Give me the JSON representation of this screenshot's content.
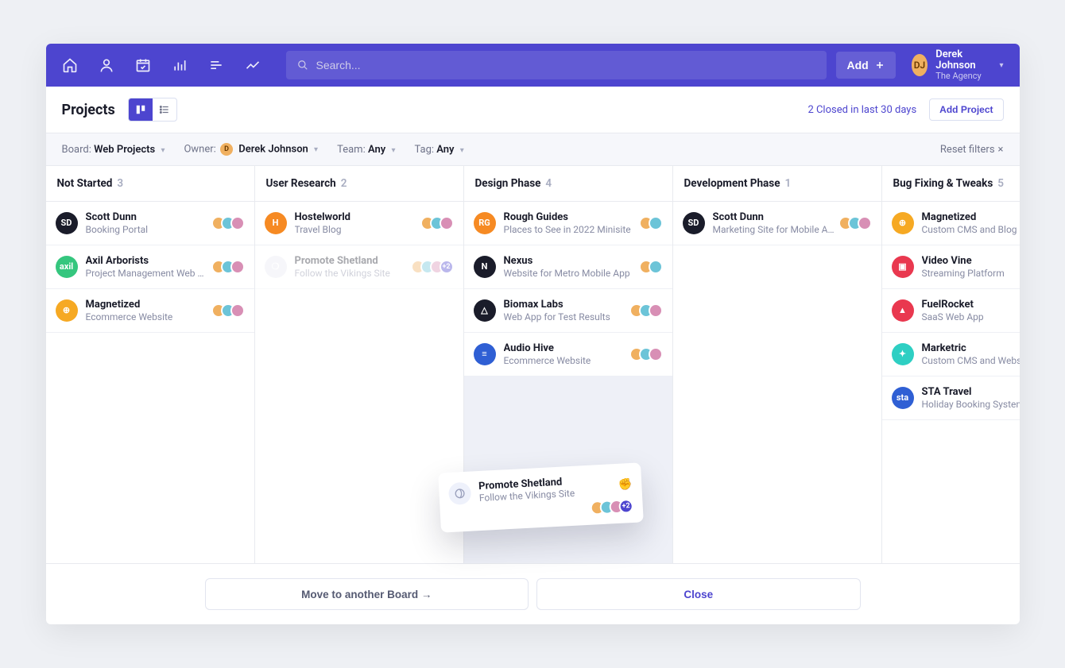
{
  "nav": {
    "search_placeholder": "Search...",
    "add_label": "Add",
    "user": {
      "name": "Derek Johnson",
      "org": "The Agency",
      "initials": "DJ"
    }
  },
  "header": {
    "title": "Projects",
    "closed_text": "2 Closed in last 30 days",
    "add_project": "Add Project"
  },
  "filters": {
    "board_label": "Board:",
    "board_value": "Web Projects",
    "owner_label": "Owner:",
    "owner_value": "Derek Johnson",
    "team_label": "Team:",
    "team_value": "Any",
    "tag_label": "Tag:",
    "tag_value": "Any",
    "reset": "Reset filters"
  },
  "columns": [
    {
      "title": "Not Started",
      "count": "3",
      "cards": [
        {
          "title": "Scott Dunn",
          "sub": "Booking Portal",
          "bg": "#1a1c2a",
          "abbr": "SD",
          "av": 3
        },
        {
          "title": "Axil Arborists",
          "sub": "Project Management Web App",
          "bg": "#35c67e",
          "abbr": "axil",
          "av": 3
        },
        {
          "title": "Magnetized",
          "sub": "Ecommerce Website",
          "bg": "#f6a923",
          "abbr": "⊕",
          "av": 3
        }
      ]
    },
    {
      "title": "User Research",
      "count": "2",
      "cards": [
        {
          "title": "Hostelworld",
          "sub": "Travel Blog",
          "bg": "#f68a23",
          "abbr": "H",
          "av": 3
        },
        {
          "title": "Promote Shetland",
          "sub": "Follow the Vikings Site",
          "bg": "#e8eaf3",
          "abbr": "❍",
          "av": 3,
          "ghost": true,
          "extra": "+2"
        }
      ]
    },
    {
      "title": "Design Phase",
      "count": "4",
      "highlight": true,
      "cards": [
        {
          "title": "Rough Guides",
          "sub": "Places to See in 2022 Minisite",
          "bg": "#f68a23",
          "abbr": "RG",
          "av": 2
        },
        {
          "title": "Nexus",
          "sub": "Website for Metro Mobile App",
          "bg": "#1a1c2a",
          "abbr": "N",
          "av": 2
        },
        {
          "title": "Biomax Labs",
          "sub": "Web App for Test Results",
          "bg": "#1a1c2a",
          "abbr": "△",
          "av": 3
        },
        {
          "title": "Audio Hive",
          "sub": "Ecommerce Website",
          "bg": "#2f5fd4",
          "abbr": "≡",
          "av": 3
        }
      ]
    },
    {
      "title": "Development Phase",
      "count": "1",
      "cards": [
        {
          "title": "Scott Dunn",
          "sub": "Marketing Site for Mobile A…",
          "bg": "#1a1c2a",
          "abbr": "SD",
          "av": 3
        }
      ]
    },
    {
      "title": "Bug Fixing & Tweaks",
      "count": "5",
      "cards": [
        {
          "title": "Magnetized",
          "sub": "Custom CMS and Blog",
          "bg": "#f6a923",
          "abbr": "⊕",
          "av": 0
        },
        {
          "title": "Video Vine",
          "sub": "Streaming Platform",
          "bg": "#e9384f",
          "abbr": "▣",
          "av": 0
        },
        {
          "title": "FuelRocket",
          "sub": "SaaS Web App",
          "bg": "#e9384f",
          "abbr": "▲",
          "av": 0
        },
        {
          "title": "Marketric",
          "sub": "Custom CMS and Websi",
          "bg": "#2ecfc3",
          "abbr": "✦",
          "av": 0
        },
        {
          "title": "STA Travel",
          "sub": "Holiday Booking System",
          "bg": "#2f5fd4",
          "abbr": "sta",
          "av": 0
        }
      ]
    }
  ],
  "drag": {
    "title": "Promote Shetland",
    "sub": "Follow the Vikings Site",
    "extra": "+2"
  },
  "footer": {
    "move": "Move to another Board →",
    "close": "Close"
  },
  "avatar_colors": [
    "#f0b060",
    "#6cc4d8",
    "#d88fb5",
    "#8fa3d8"
  ]
}
